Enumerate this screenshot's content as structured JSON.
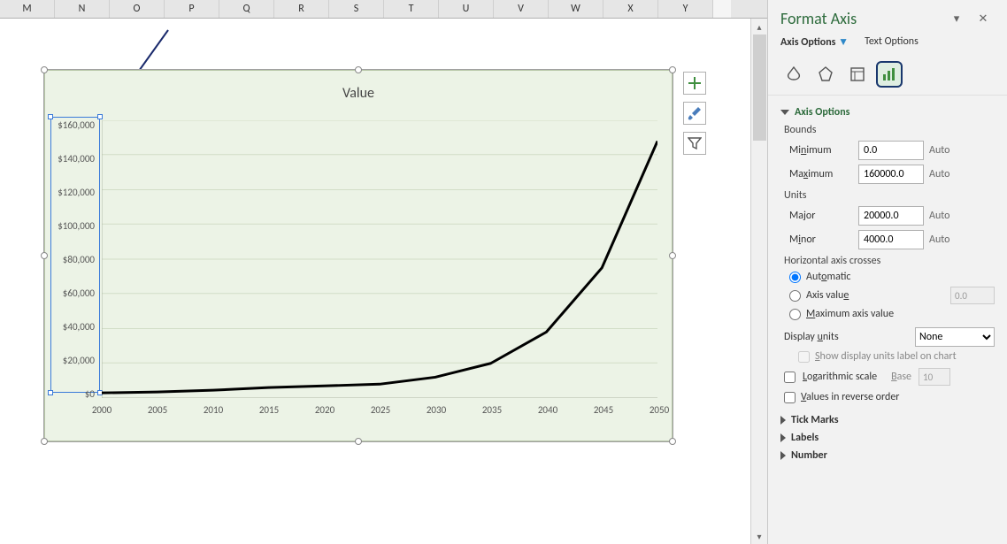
{
  "columns": [
    "M",
    "N",
    "O",
    "P",
    "Q",
    "R",
    "S",
    "T",
    "U",
    "V",
    "W",
    "X",
    "Y"
  ],
  "chart": {
    "title": "Value"
  },
  "chart_data": {
    "type": "line",
    "title": "Value",
    "xlabel": "",
    "ylabel": "",
    "xlim": [
      2000,
      2050
    ],
    "ylim": [
      0,
      160000
    ],
    "x_ticks": [
      2000,
      2005,
      2010,
      2015,
      2020,
      2025,
      2030,
      2035,
      2040,
      2045,
      2050
    ],
    "y_ticks": [
      "$0",
      "$20,000",
      "$40,000",
      "$60,000",
      "$80,000",
      "$100,000",
      "$120,000",
      "$140,000",
      "$160,000"
    ],
    "series": [
      {
        "name": "Value",
        "x": [
          2000,
          2005,
          2010,
          2015,
          2020,
          2025,
          2030,
          2035,
          2040,
          2045,
          2050
        ],
        "y": [
          3000,
          3500,
          4500,
          6000,
          7000,
          8000,
          12000,
          20000,
          38000,
          75000,
          148000
        ]
      }
    ]
  },
  "float_btns": {
    "plus": "+",
    "brush": "brush",
    "filter": "filter"
  },
  "pane": {
    "title": "Format Axis",
    "tabs": {
      "axis": "Axis Options",
      "text": "Text Options"
    },
    "sections": {
      "axis_options": "Axis Options",
      "bounds": "Bounds",
      "min_l": "Minimum",
      "min_v": "0.0",
      "min_a": "Auto",
      "max_l": "Maximum",
      "max_v": "160000.0",
      "max_a": "Auto",
      "units": "Units",
      "maj_l": "Major",
      "maj_v": "20000.0",
      "maj_a": "Auto",
      "mnr_l": "Minor",
      "mnr_v": "4000.0",
      "mnr_a": "Auto",
      "hcross": "Horizontal axis crosses",
      "auto_r": "Automatic",
      "axval_r": "Axis value",
      "axval_v": "0.0",
      "maxval_r": "Maximum axis value",
      "du_l": "Display units",
      "du_v": "None",
      "du_chk": "Show display units label on chart",
      "log_l": "Logarithmic scale",
      "log_base_l": "Base",
      "log_base_v": "10",
      "rev_l": "Values in reverse order",
      "tick": "Tick Marks",
      "labels": "Labels",
      "number": "Number"
    }
  }
}
